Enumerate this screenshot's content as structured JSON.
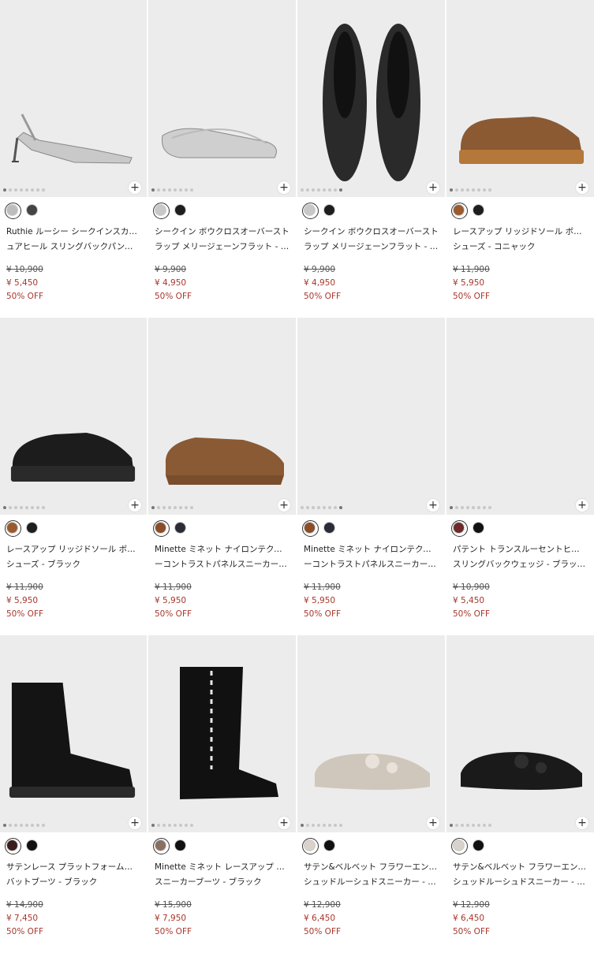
{
  "products": [
    {
      "name_line1": "Ruthie ルーシー シークインスカルプチ",
      "name_line2": "ュアヒール スリングバックパンプス...",
      "original_price": "¥ 10,900",
      "sale_price": "¥ 5,450",
      "discount": "50% OFF",
      "swatches": [
        "#bdbdbd",
        "#444444"
      ],
      "image_icon": "silver-slingback-heel-image",
      "active_dot": 0
    },
    {
      "name_line1": "シークイン ボウクロスオーバースト",
      "name_line2": "ラップ メリージェーンフラット - シ...",
      "original_price": "¥ 9,900",
      "sale_price": "¥ 4,950",
      "discount": "50% OFF",
      "swatches": [
        "#c8c8c8",
        "#1e1e1e"
      ],
      "image_icon": "silver-sequin-flat-image",
      "active_dot": 0
    },
    {
      "name_line1": "シークイン ボウクロスオーバースト",
      "name_line2": "ラップ メリージェーンフラット - ブ...",
      "original_price": "¥ 9,900",
      "sale_price": "¥ 4,950",
      "discount": "50% OFF",
      "swatches": [
        "#c8c8c8",
        "#1e1e1e"
      ],
      "image_icon": "black-sequin-flat-image",
      "active_dot": 7
    },
    {
      "name_line1": "レースアップ リッジドソール ボート",
      "name_line2": "シューズ - コニャック",
      "original_price": "¥ 11,900",
      "sale_price": "¥ 5,950",
      "discount": "50% OFF",
      "swatches": [
        "#9b5a2e",
        "#1e1e1e"
      ],
      "image_icon": "cognac-boat-shoe-image",
      "active_dot": 0
    },
    {
      "name_line1": "レースアップ リッジドソール ボート",
      "name_line2": "シューズ - ブラック",
      "original_price": "¥ 11,900",
      "sale_price": "¥ 5,950",
      "discount": "50% OFF",
      "swatches": [
        "#9b5a2e",
        "#1e1e1e"
      ],
      "image_icon": "black-boat-shoe-image",
      "active_dot": 0
    },
    {
      "name_line1": "Minette ミネット ナイロンテクスチャ",
      "name_line2": "ーコントラストパネルスニーカー - ...",
      "original_price": "¥ 11,900",
      "sale_price": "¥ 5,950",
      "discount": "50% OFF",
      "swatches": [
        "#8a4e28",
        "#2a2d36"
      ],
      "image_icon": "brown-sneaker-image",
      "active_dot": 0
    },
    {
      "name_line1": "Minette ミネット ナイロンテクスチャ",
      "name_line2": "ーコントラストパネルスニーカー - ...",
      "original_price": "¥ 11,900",
      "sale_price": "¥ 5,950",
      "discount": "50% OFF",
      "swatches": [
        "#8a4e28",
        "#2a2d36"
      ],
      "image_icon": "model-black-sneaker-image",
      "active_dot": 7
    },
    {
      "name_line1": "パテント トランスルーセントヒール",
      "name_line2": "スリングバックウェッジ - ブラック...",
      "original_price": "¥ 10,900",
      "sale_price": "¥ 5,450",
      "discount": "50% OFF",
      "swatches": [
        "#6e2a2a",
        "#111111"
      ],
      "image_icon": "black-patent-wedge-image",
      "active_dot": 0
    },
    {
      "name_line1": "サテンレース プラットフォームコン",
      "name_line2": "バットブーツ - ブラック",
      "original_price": "¥ 14,900",
      "sale_price": "¥ 7,450",
      "discount": "50% OFF",
      "swatches": [
        "#3a1e1e",
        "#111111"
      ],
      "image_icon": "black-combat-boot-image",
      "active_dot": 0
    },
    {
      "name_line1": "Minette ミネット レースアップ ロング",
      "name_line2": "スニーカーブーツ - ブラック",
      "original_price": "¥ 15,900",
      "sale_price": "¥ 7,950",
      "discount": "50% OFF",
      "swatches": [
        "#8a7060",
        "#111111"
      ],
      "image_icon": "black-long-sneaker-boot-image",
      "active_dot": 0
    },
    {
      "name_line1": "サテン&ベルベット フラワーエンベリ",
      "name_line2": "シュッドルーシュドスニーカー - ラ...",
      "original_price": "¥ 12,900",
      "sale_price": "¥ 6,450",
      "discount": "50% OFF",
      "swatches": [
        "#d8d2ca",
        "#111111"
      ],
      "image_icon": "light-flower-sneaker-image",
      "active_dot": 0
    },
    {
      "name_line1": "サテン&ベルベット フラワーエンベリ",
      "name_line2": "シュッドルーシュドスニーカー - ブ...",
      "original_price": "¥ 12,900",
      "sale_price": "¥ 6,450",
      "discount": "50% OFF",
      "swatches": [
        "#d8d2ca",
        "#111111"
      ],
      "image_icon": "black-flower-sneaker-image",
      "active_dot": 0
    }
  ],
  "add_icon": "plus-icon"
}
